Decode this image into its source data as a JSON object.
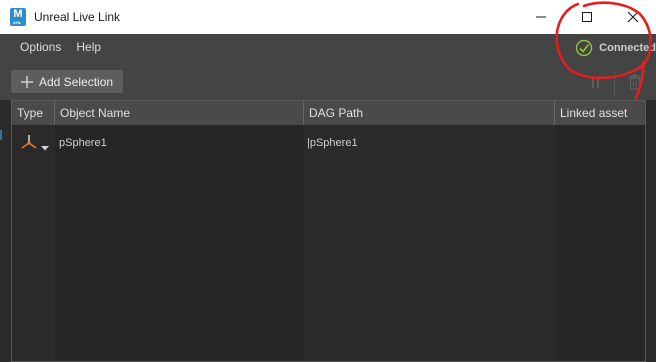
{
  "window": {
    "title": "Unreal Live Link",
    "app_icon_letter": "M",
    "app_icon_sub": "AYA"
  },
  "menu": {
    "items": [
      "Options",
      "Help"
    ]
  },
  "status": {
    "label": "Connected"
  },
  "toolbar": {
    "add_selection_label": "Add Selection"
  },
  "table": {
    "columns": [
      "Type",
      "Object Name",
      "DAG Path",
      "Linked asset"
    ],
    "rows": [
      {
        "type_icon": "joint-axis-icon",
        "object_name": "pSphere1",
        "dag_path": "|pSphere1",
        "linked_asset": ""
      }
    ]
  },
  "colors": {
    "accent_blue": "#2f8ec9",
    "status_green": "#8fc43f",
    "annotation_red": "#e41e1e"
  }
}
